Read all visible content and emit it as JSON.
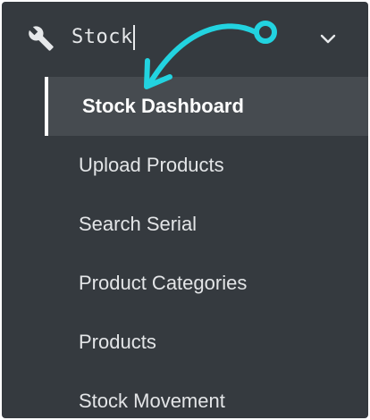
{
  "menu": {
    "section": {
      "label": "Stock",
      "icon": "wrench-icon",
      "expand_icon": "chevron-down-icon"
    },
    "items": [
      {
        "label": "Stock Dashboard",
        "active": true
      },
      {
        "label": "Upload Products"
      },
      {
        "label": "Search Serial"
      },
      {
        "label": "Product Categories"
      },
      {
        "label": "Products"
      },
      {
        "label": "Stock Movement"
      }
    ]
  },
  "annotation": {
    "icon": "curved-arrow-icon",
    "color": "#22d3e0"
  },
  "colors": {
    "sidebar_bg": "#353a3f",
    "active_bg": "#464b50",
    "text": "#e3e5e7"
  }
}
